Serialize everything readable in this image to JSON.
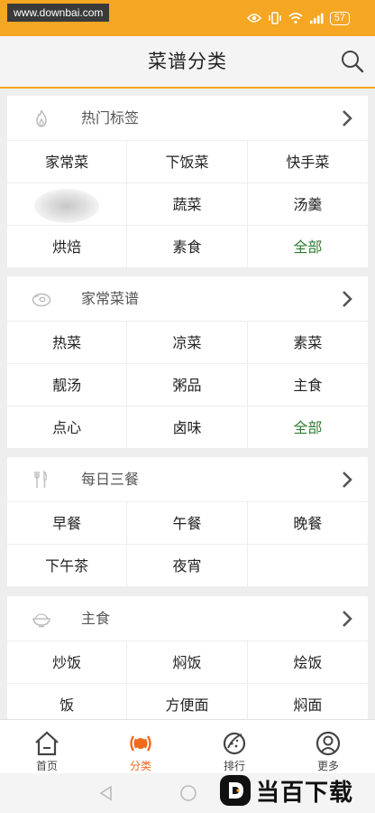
{
  "status_bar": {
    "watermark": "www.downbai.com",
    "battery": "57"
  },
  "header": {
    "title": "菜谱分类"
  },
  "sections": [
    {
      "title": "热门标签",
      "icon": "fire-icon",
      "items": [
        {
          "label": "家常菜"
        },
        {
          "label": "下饭菜"
        },
        {
          "label": "快手菜"
        },
        {
          "label": ""
        },
        {
          "label": "蔬菜"
        },
        {
          "label": "汤羹"
        },
        {
          "label": "烘焙"
        },
        {
          "label": "素食"
        },
        {
          "label": "全部",
          "highlight": true
        }
      ]
    },
    {
      "title": "家常菜谱",
      "icon": "meat-icon",
      "items": [
        {
          "label": "热菜"
        },
        {
          "label": "凉菜"
        },
        {
          "label": "素菜"
        },
        {
          "label": "靓汤"
        },
        {
          "label": "粥品"
        },
        {
          "label": "主食"
        },
        {
          "label": "点心"
        },
        {
          "label": "卤味"
        },
        {
          "label": "全部",
          "highlight": true
        }
      ]
    },
    {
      "title": "每日三餐",
      "icon": "utensils-icon",
      "items": [
        {
          "label": "早餐"
        },
        {
          "label": "午餐"
        },
        {
          "label": "晚餐"
        },
        {
          "label": "下午茶"
        },
        {
          "label": "夜宵"
        },
        {
          "label": ""
        }
      ]
    },
    {
      "title": "主食",
      "icon": "rice-bowl-icon",
      "items": [
        {
          "label": "炒饭"
        },
        {
          "label": "焖饭"
        },
        {
          "label": "烩饭"
        },
        {
          "label": "饭"
        },
        {
          "label": "方便面"
        },
        {
          "label": "焖面"
        }
      ]
    }
  ],
  "bottom_nav": [
    {
      "label": "首页",
      "icon": "home-icon",
      "active": false
    },
    {
      "label": "分类",
      "icon": "category-icon",
      "active": true
    },
    {
      "label": "排行",
      "icon": "ranking-icon",
      "active": false
    },
    {
      "label": "更多",
      "icon": "more-icon",
      "active": false
    }
  ],
  "brand_watermark": {
    "text": "当百下载",
    "logo": "D"
  },
  "colors": {
    "accent": "#f5a623",
    "active": "#f26a1b",
    "all_link": "#2e7d32"
  }
}
